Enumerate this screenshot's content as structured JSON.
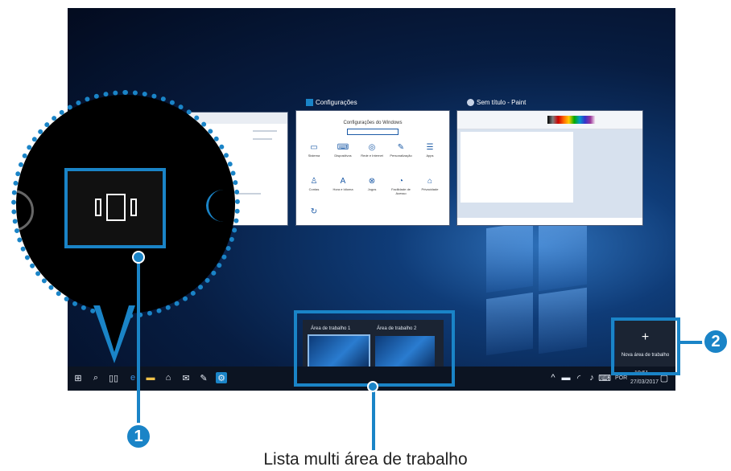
{
  "windows": {
    "explorer": {
      "title": ""
    },
    "settings": {
      "title": "Configurações",
      "heading": "Configurações do Windows",
      "items": [
        "Sistema",
        "Dispositivos",
        "Rede e Internet",
        "Personalização",
        "Apps",
        "Contas",
        "Hora e Idioma",
        "Jogos",
        "Facilidade de Acesso",
        "Privacidade"
      ]
    },
    "paint": {
      "title": "Sem título - Paint"
    }
  },
  "desktops": {
    "items": [
      {
        "label": "Área de trabalho 1"
      },
      {
        "label": "Área de trabalho 2"
      }
    ],
    "new_desktop_label": "Nova área de trabalho",
    "new_desktop_icon": "+"
  },
  "tray": {
    "language": "POR",
    "time": "10:51",
    "date": "27/03/2017"
  },
  "callouts": {
    "badge_1": "1",
    "badge_2": "2"
  },
  "caption": "Lista multi área de trabalho",
  "colors": {
    "accent": "#1a84c7"
  }
}
